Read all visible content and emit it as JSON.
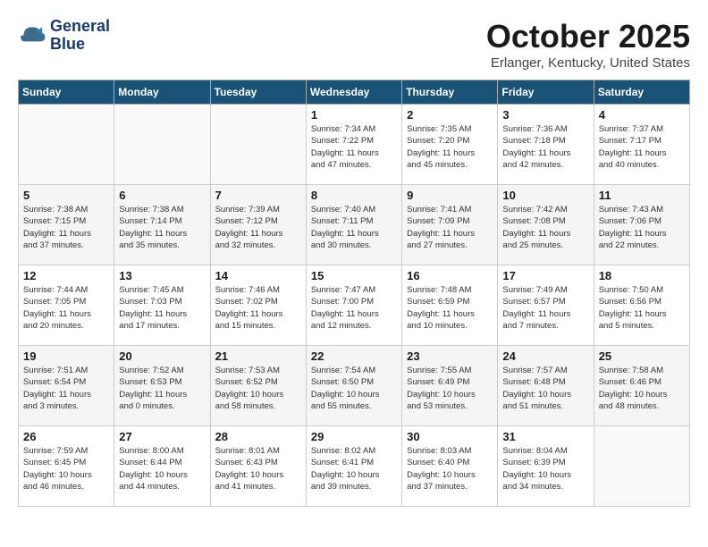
{
  "logo": {
    "line1": "General",
    "line2": "Blue"
  },
  "header": {
    "month": "October 2025",
    "location": "Erlanger, Kentucky, United States"
  },
  "weekdays": [
    "Sunday",
    "Monday",
    "Tuesday",
    "Wednesday",
    "Thursday",
    "Friday",
    "Saturday"
  ],
  "weeks": [
    [
      {
        "day": "",
        "info": ""
      },
      {
        "day": "",
        "info": ""
      },
      {
        "day": "",
        "info": ""
      },
      {
        "day": "1",
        "info": "Sunrise: 7:34 AM\nSunset: 7:22 PM\nDaylight: 11 hours\nand 47 minutes."
      },
      {
        "day": "2",
        "info": "Sunrise: 7:35 AM\nSunset: 7:20 PM\nDaylight: 11 hours\nand 45 minutes."
      },
      {
        "day": "3",
        "info": "Sunrise: 7:36 AM\nSunset: 7:18 PM\nDaylight: 11 hours\nand 42 minutes."
      },
      {
        "day": "4",
        "info": "Sunrise: 7:37 AM\nSunset: 7:17 PM\nDaylight: 11 hours\nand 40 minutes."
      }
    ],
    [
      {
        "day": "5",
        "info": "Sunrise: 7:38 AM\nSunset: 7:15 PM\nDaylight: 11 hours\nand 37 minutes."
      },
      {
        "day": "6",
        "info": "Sunrise: 7:38 AM\nSunset: 7:14 PM\nDaylight: 11 hours\nand 35 minutes."
      },
      {
        "day": "7",
        "info": "Sunrise: 7:39 AM\nSunset: 7:12 PM\nDaylight: 11 hours\nand 32 minutes."
      },
      {
        "day": "8",
        "info": "Sunrise: 7:40 AM\nSunset: 7:11 PM\nDaylight: 11 hours\nand 30 minutes."
      },
      {
        "day": "9",
        "info": "Sunrise: 7:41 AM\nSunset: 7:09 PM\nDaylight: 11 hours\nand 27 minutes."
      },
      {
        "day": "10",
        "info": "Sunrise: 7:42 AM\nSunset: 7:08 PM\nDaylight: 11 hours\nand 25 minutes."
      },
      {
        "day": "11",
        "info": "Sunrise: 7:43 AM\nSunset: 7:06 PM\nDaylight: 11 hours\nand 22 minutes."
      }
    ],
    [
      {
        "day": "12",
        "info": "Sunrise: 7:44 AM\nSunset: 7:05 PM\nDaylight: 11 hours\nand 20 minutes."
      },
      {
        "day": "13",
        "info": "Sunrise: 7:45 AM\nSunset: 7:03 PM\nDaylight: 11 hours\nand 17 minutes."
      },
      {
        "day": "14",
        "info": "Sunrise: 7:46 AM\nSunset: 7:02 PM\nDaylight: 11 hours\nand 15 minutes."
      },
      {
        "day": "15",
        "info": "Sunrise: 7:47 AM\nSunset: 7:00 PM\nDaylight: 11 hours\nand 12 minutes."
      },
      {
        "day": "16",
        "info": "Sunrise: 7:48 AM\nSunset: 6:59 PM\nDaylight: 11 hours\nand 10 minutes."
      },
      {
        "day": "17",
        "info": "Sunrise: 7:49 AM\nSunset: 6:57 PM\nDaylight: 11 hours\nand 7 minutes."
      },
      {
        "day": "18",
        "info": "Sunrise: 7:50 AM\nSunset: 6:56 PM\nDaylight: 11 hours\nand 5 minutes."
      }
    ],
    [
      {
        "day": "19",
        "info": "Sunrise: 7:51 AM\nSunset: 6:54 PM\nDaylight: 11 hours\nand 3 minutes."
      },
      {
        "day": "20",
        "info": "Sunrise: 7:52 AM\nSunset: 6:53 PM\nDaylight: 11 hours\nand 0 minutes."
      },
      {
        "day": "21",
        "info": "Sunrise: 7:53 AM\nSunset: 6:52 PM\nDaylight: 10 hours\nand 58 minutes."
      },
      {
        "day": "22",
        "info": "Sunrise: 7:54 AM\nSunset: 6:50 PM\nDaylight: 10 hours\nand 55 minutes."
      },
      {
        "day": "23",
        "info": "Sunrise: 7:55 AM\nSunset: 6:49 PM\nDaylight: 10 hours\nand 53 minutes."
      },
      {
        "day": "24",
        "info": "Sunrise: 7:57 AM\nSunset: 6:48 PM\nDaylight: 10 hours\nand 51 minutes."
      },
      {
        "day": "25",
        "info": "Sunrise: 7:58 AM\nSunset: 6:46 PM\nDaylight: 10 hours\nand 48 minutes."
      }
    ],
    [
      {
        "day": "26",
        "info": "Sunrise: 7:59 AM\nSunset: 6:45 PM\nDaylight: 10 hours\nand 46 minutes."
      },
      {
        "day": "27",
        "info": "Sunrise: 8:00 AM\nSunset: 6:44 PM\nDaylight: 10 hours\nand 44 minutes."
      },
      {
        "day": "28",
        "info": "Sunrise: 8:01 AM\nSunset: 6:43 PM\nDaylight: 10 hours\nand 41 minutes."
      },
      {
        "day": "29",
        "info": "Sunrise: 8:02 AM\nSunset: 6:41 PM\nDaylight: 10 hours\nand 39 minutes."
      },
      {
        "day": "30",
        "info": "Sunrise: 8:03 AM\nSunset: 6:40 PM\nDaylight: 10 hours\nand 37 minutes."
      },
      {
        "day": "31",
        "info": "Sunrise: 8:04 AM\nSunset: 6:39 PM\nDaylight: 10 hours\nand 34 minutes."
      },
      {
        "day": "",
        "info": ""
      }
    ]
  ]
}
